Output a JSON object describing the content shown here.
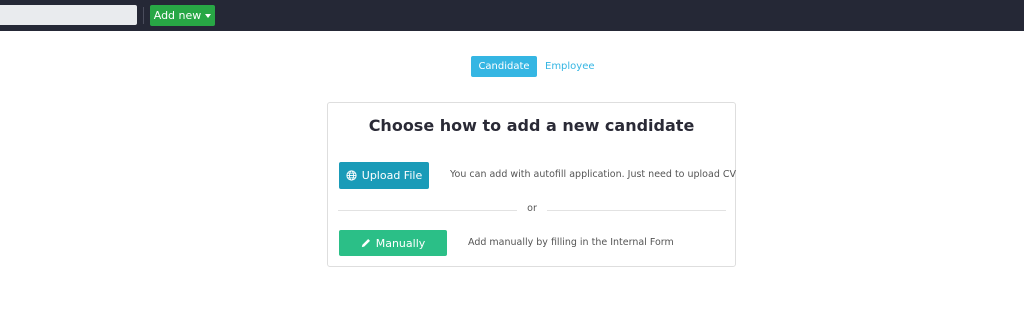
{
  "topbar": {
    "search": {
      "value": "",
      "placeholder": ""
    },
    "add_new_label": "Add new"
  },
  "tabs": [
    {
      "label": "Candidate",
      "active": true
    },
    {
      "label": "Employee",
      "active": false
    }
  ],
  "card": {
    "title": "Choose how to add a new candidate",
    "upload": {
      "label": "Upload File",
      "icon": "globe-icon",
      "description": "You can add with autofill application. Just need to upload CV"
    },
    "separator_text": "or",
    "manual": {
      "label": "Manually",
      "icon": "pencil-icon",
      "description": "Add manually by filling in the Internal Form"
    }
  },
  "colors": {
    "topbar_bg": "#252836",
    "add_new_bg": "#28a745",
    "tab_active_bg": "#35b6e3",
    "upload_bg": "#1a9bb8",
    "manual_bg": "#2bbf87"
  }
}
